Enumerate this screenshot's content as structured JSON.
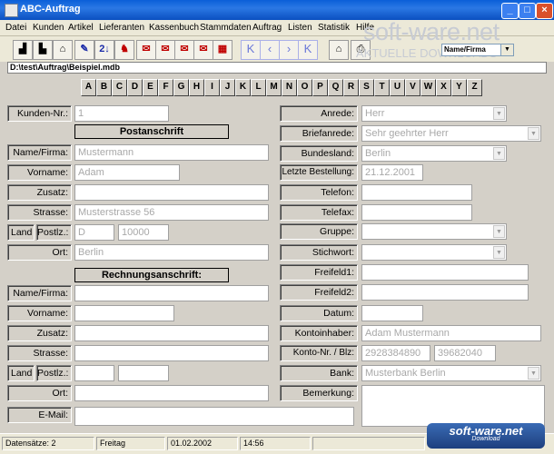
{
  "window": {
    "title": "ABC-Auftrag",
    "min": "_",
    "max": "□",
    "close": "×"
  },
  "menu": [
    "Datei",
    "Kunden",
    "Artikel",
    "Lieferanten",
    "Kassenbuch",
    "Stammdaten",
    "Auftrag",
    "Listen",
    "Statistik",
    "Hilfe"
  ],
  "toolbar": {
    "buttons": [
      "▟",
      "▙",
      "⌂",
      "✎",
      "2↓",
      "♞",
      "✉",
      "✉",
      "✉",
      "✉",
      "▦",
      "K",
      "‹",
      "›",
      "K",
      "⌂",
      "⎙"
    ],
    "sort_label": "Name/Firma",
    "sort_arrow": "▼"
  },
  "watermark": {
    "big": "soft-ware.net",
    "small": "AKTUELLE DOWNLOADS"
  },
  "path": "D:\\test\\Auftrag\\Beispiel.mdb",
  "letters": [
    "A",
    "B",
    "C",
    "D",
    "E",
    "F",
    "G",
    "H",
    "I",
    "J",
    "K",
    "L",
    "M",
    "N",
    "O",
    "P",
    "Q",
    "R",
    "S",
    "T",
    "U",
    "V",
    "W",
    "X",
    "Y",
    "Z"
  ],
  "left": {
    "kundennr_label": "Kunden-Nr.:",
    "kundennr": "1",
    "postanschrift": "Postanschrift",
    "name_label": "Name/Firma:",
    "name": "Mustermann",
    "vorname_label": "Vorname:",
    "vorname": "Adam",
    "zusatz_label": "Zusatz:",
    "zusatz": "",
    "strasse_label": "Strasse:",
    "strasse": "Musterstrasse 56",
    "land_label": "Land",
    "postlz_label": "Postlz.:",
    "land": "D",
    "plz": "10000",
    "ort_label": "Ort:",
    "ort": "Berlin",
    "rechnungsanschrift": "Rechnungsanschrift:",
    "r_name_label": "Name/Firma:",
    "r_vorname_label": "Vorname:",
    "r_zusatz_label": "Zusatz:",
    "r_strasse_label": "Strasse:",
    "r_land_label": "Land",
    "r_postlz_label": "Postlz.:",
    "r_ort_label": "Ort:",
    "email_label": "E-Mail:"
  },
  "right": {
    "anrede_label": "Anrede:",
    "anrede": "Herr",
    "briefanrede_label": "Briefanrede:",
    "briefanrede": "Sehr geehrter Herr",
    "bundesland_label": "Bundesland:",
    "bundesland": "Berlin",
    "letzte_label": "Letzte Bestellung:",
    "letzte": "21.12.2001",
    "telefon_label": "Telefon:",
    "telefax_label": "Telefax:",
    "gruppe_label": "Gruppe:",
    "stichwort_label": "Stichwort:",
    "freifeld1_label": "Freifeld1:",
    "freifeld2_label": "Freifeld2:",
    "datum_label": "Datum:",
    "kontoinhaber_label": "Kontoinhaber:",
    "kontoinhaber": "Adam Mustermann",
    "konto_label": "Konto-Nr. / Blz:",
    "kontonr": "2928384890",
    "blz": "39682040",
    "bank_label": "Bank:",
    "bank": "Musterbank Berlin",
    "bemerkung_label": "Bemerkung:"
  },
  "status": {
    "records": "Datensätze: 2",
    "day": "Freitag",
    "date": "01.02.2002",
    "time": "14:56"
  },
  "watermark2": {
    "a": "soft-ware.net",
    "b": "Download"
  }
}
